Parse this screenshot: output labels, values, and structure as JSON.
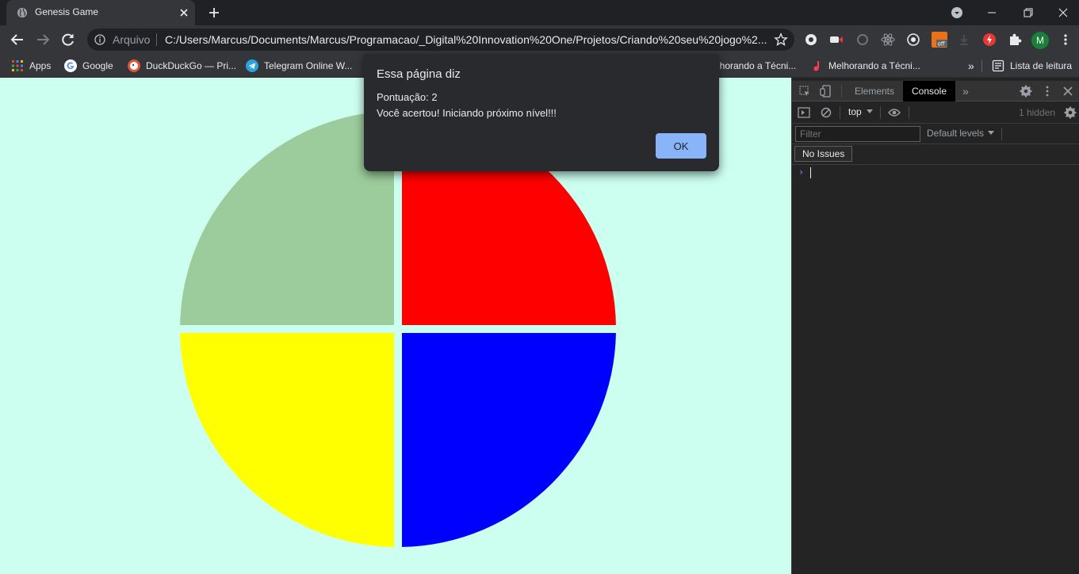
{
  "tab": {
    "title": "Genesis Game"
  },
  "omnibox": {
    "scheme_label": "Arquivo",
    "url": "C:/Users/Marcus/Documents/Marcus/Programacao/_Digital%20Innovation%20One/Projetos/Criando%20seu%20jogo%2..."
  },
  "bookmarks": {
    "items": [
      {
        "label": "Apps",
        "icon": "apps-grid-icon"
      },
      {
        "label": "Google",
        "icon": "google-icon"
      },
      {
        "label": "DuckDuckGo — Pri...",
        "icon": "duckduckgo-icon"
      },
      {
        "label": "Telegram Online W...",
        "icon": "telegram-icon"
      },
      {
        "label": "lhorando a Técni...",
        "icon": ""
      },
      {
        "label": "Melhorando a Técni...",
        "icon": "music-note-icon"
      }
    ],
    "overflow": "»",
    "reading_list": "Lista de leitura"
  },
  "profile": {
    "initial": "M"
  },
  "game": {
    "colors": {
      "green": "#9ccc9c",
      "red": "#ff0000",
      "yellow": "#ffff00",
      "blue": "#0000ff",
      "background": "#ccfff0"
    }
  },
  "devtools": {
    "tabs": [
      "Elements",
      "Console"
    ],
    "active_tab": "Console",
    "context": "top",
    "hidden_count": "1 hidden",
    "filter_placeholder": "Filter",
    "levels": "Default levels",
    "issues": "No Issues",
    "prompt": "›"
  },
  "dialog": {
    "title": "Essa página diz",
    "line1": "Pontuação: 2",
    "line2": "Você acertou! Iniciando próximo nível!!!",
    "ok": "OK"
  }
}
